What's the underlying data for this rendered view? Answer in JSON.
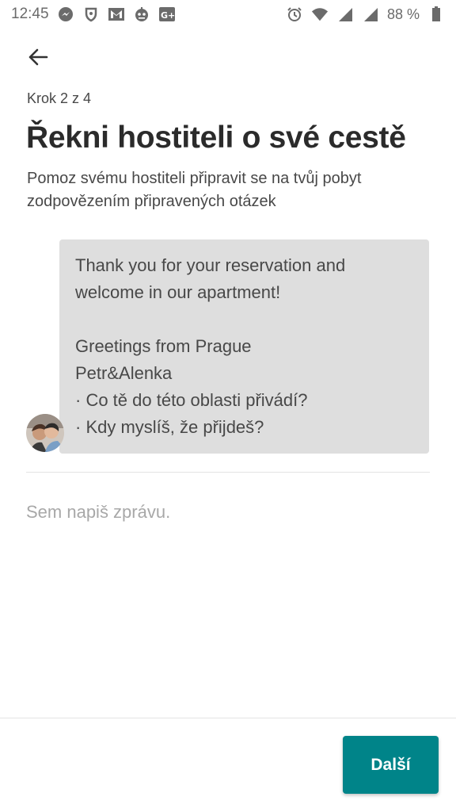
{
  "status_bar": {
    "time": "12:45",
    "battery": "88 %",
    "left_icons": [
      "messenger-icon",
      "shield-icon",
      "gmail-icon",
      "robot-icon",
      "google-plus-icon"
    ],
    "right_icons": [
      "alarm-icon",
      "wifi-icon",
      "signal-icon",
      "signal-icon",
      "battery-icon"
    ]
  },
  "header": {
    "back_icon": "arrow-left-icon",
    "step": "Krok 2 z 4",
    "title": "Řekni hostiteli o své cestě",
    "subtitle_line1": "Pomoz svému hostiteli připravit se na tvůj pobyt",
    "subtitle_line2": "zodpovězením připravených otázek"
  },
  "host_message": {
    "avatar": "host-avatar",
    "lines": [
      "Thank you for your reservation and",
      "welcome in our apartment!",
      "",
      "Greetings from Prague",
      "Petr&Alenka",
      " · Co tě do této oblasti přivádí?",
      " · Kdy myslíš, že přijdeš?"
    ]
  },
  "composer": {
    "placeholder": "Sem napiš zprávu.",
    "value": ""
  },
  "footer": {
    "next_label": "Další"
  },
  "colors": {
    "accent": "#008489",
    "bubble": "#dedede",
    "text": "#484848"
  }
}
